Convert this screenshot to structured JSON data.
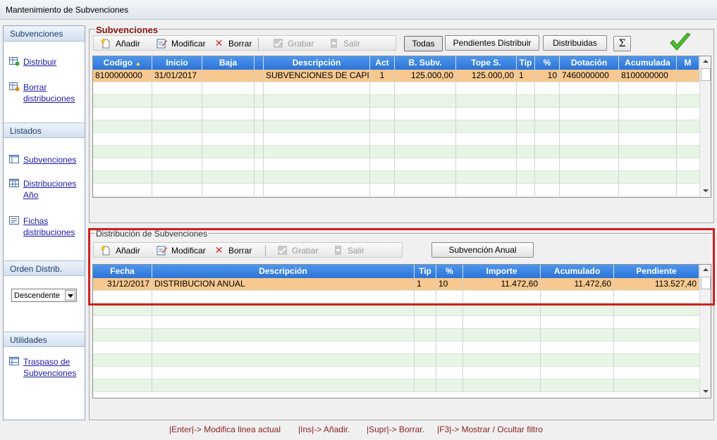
{
  "window": {
    "title": "Mantenimiento de Subvenciones"
  },
  "sidebar": {
    "sections": [
      {
        "title": "Subvenciones",
        "items": [
          {
            "label": "Distribuir",
            "icon": "table-add-icon"
          },
          {
            "label": "Borrar distribuciones",
            "icon": "table-delete-icon"
          }
        ]
      },
      {
        "title": "Listados",
        "items": [
          {
            "label": "Subvenciones",
            "icon": "list-icon"
          },
          {
            "label": "Distribuciones Año",
            "icon": "grid-icon"
          },
          {
            "label": "Fichas distribuciones",
            "icon": "cards-icon"
          }
        ]
      },
      {
        "title": "Orden Distrib.",
        "select_value": "Descendente"
      },
      {
        "title": "Utilidades",
        "items": [
          {
            "label": "Traspaso de Subvenciones",
            "icon": "transfer-icon"
          }
        ]
      }
    ]
  },
  "subvenciones": {
    "legend": "Subvenciones",
    "toolbar": {
      "add": "Añadir",
      "modify": "Modificar",
      "delete": "Borrar",
      "save": "Grabar",
      "exit": "Salir"
    },
    "filters": {
      "all": "Todas",
      "pending": "Pendientes Distribuir",
      "distributed": "Distribuidas"
    },
    "sum_symbol": "Σ",
    "columns": [
      "Codigo",
      "Inicio",
      "Baja",
      "",
      "Descripción",
      "Act",
      "B. Subv.",
      "Tope S.",
      "Tip",
      "%",
      "Dotación",
      "Acumulada",
      "M"
    ],
    "rows": [
      [
        "8100000000",
        "31/01/2017",
        "",
        "",
        "SUBVENCIONES DE CAPIT",
        "1",
        "125.000,00",
        "125.000,00",
        "1",
        "10",
        "7460000000",
        "8100000000",
        ""
      ]
    ]
  },
  "distribucion": {
    "legend": "Distribución de Subvenciones",
    "toolbar": {
      "add": "Añadir",
      "modify": "Modificar",
      "delete": "Borrar",
      "save": "Grabar",
      "exit": "Salir"
    },
    "annual_button": "Subvención Anual",
    "columns": [
      "Fecha",
      "Descripción",
      "Tip",
      "%",
      "Importe",
      "Acumulado",
      "Pendiente"
    ],
    "rows": [
      [
        "31/12/2017",
        "DISTRIBUCION ANUAL",
        "1",
        "10",
        "11.472,60",
        "11.472,60",
        "113.527,40"
      ]
    ]
  },
  "statusbar": [
    "|Enter|-> Modifica linea actual",
    "|Ins|-> Añadir.",
    "|Supr|-> Borrar.",
    "|F3|-> Mostrar / Ocultar filtro"
  ],
  "colors": {
    "header_blue": "#2d74d6",
    "selected_row": "#f7c88f",
    "alt_row": "#e7f4e6",
    "legend_red": "#8b0f0f",
    "highlight_red": "#d21f1f"
  }
}
